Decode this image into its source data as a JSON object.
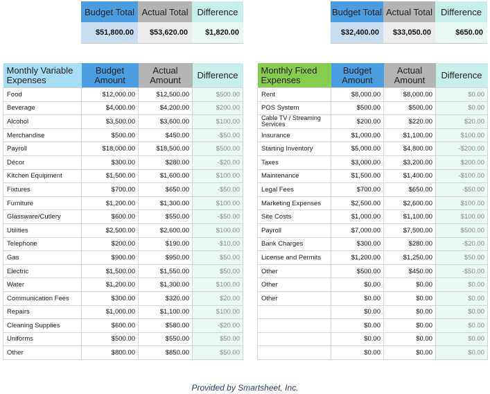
{
  "summary_variable": {
    "budget_label": "Budget Total",
    "actual_label": "Actual Total",
    "diff_label": "Difference",
    "budget_value": "$51,800.00",
    "actual_value": "$53,620.00",
    "diff_value": "$1,820.00"
  },
  "summary_fixed": {
    "budget_label": "Budget Total",
    "actual_label": "Actual Total",
    "diff_label": "Difference",
    "budget_value": "$32,400.00",
    "actual_value": "$33,050.00",
    "diff_value": "$650.00"
  },
  "variable": {
    "headers": [
      "Monthly Variable Expenses",
      "Budget Amount",
      "Actual Amount",
      "Difference"
    ],
    "rows": [
      [
        "Food",
        "$12,000.00",
        "$12,500.00",
        "$500.00"
      ],
      [
        "Beverage",
        "$4,000.00",
        "$4,200.00",
        "$200.00"
      ],
      [
        "Alcohol",
        "$3,500.00",
        "$3,600.00",
        "$100.00"
      ],
      [
        "Merchandise",
        "$500.00",
        "$450.00",
        "-$50.00"
      ],
      [
        "Payroll",
        "$18,000.00",
        "$18,500.00",
        "$500.00"
      ],
      [
        "Décor",
        "$300.00",
        "$280.00",
        "-$20.00"
      ],
      [
        "Kitchen Equipment",
        "$1,500.00",
        "$1,600.00",
        "$100.00"
      ],
      [
        "Fixtures",
        "$700.00",
        "$650.00",
        "-$50.00"
      ],
      [
        "Furniture",
        "$1,200.00",
        "$1,300.00",
        "$100.00"
      ],
      [
        "Glassware/Cutlery",
        "$600.00",
        "$550.00",
        "-$50.00"
      ],
      [
        "Utilities",
        "$2,500.00",
        "$2,600.00",
        "$100.00"
      ],
      [
        "Telephone",
        "$200.00",
        "$190.00",
        "-$10.00"
      ],
      [
        "Gas",
        "$900.00",
        "$950.00",
        "$50.00"
      ],
      [
        "Electric",
        "$1,500.00",
        "$1,550.00",
        "$50.00"
      ],
      [
        "Water",
        "$1,200.00",
        "$1,300.00",
        "$100.00"
      ],
      [
        "Communication Fees",
        "$300.00",
        "$320.00",
        "$20.00"
      ],
      [
        "Repairs",
        "$1,000.00",
        "$1,100.00",
        "$100.00"
      ],
      [
        "Cleaning Supplies",
        "$600.00",
        "$580.00",
        "-$20.00"
      ],
      [
        "Uniforms",
        "$500.00",
        "$550.00",
        "$50.00"
      ],
      [
        "Other",
        "$800.00",
        "$850.00",
        "$50.00"
      ]
    ]
  },
  "fixed": {
    "headers": [
      "Monthly Fixed Expenses",
      "Budget Amount",
      "Actual Amount",
      "Difference"
    ],
    "rows": [
      [
        "Rent",
        "$8,000.00",
        "$8,000.00",
        "$0.00"
      ],
      [
        "POS System",
        "$500.00",
        "$500.00",
        "$0.00"
      ],
      [
        "Cable TV / Streaming Services",
        "$200.00",
        "$220.00",
        "$20.00"
      ],
      [
        "Insurance",
        "$1,000.00",
        "$1,100.00",
        "$100.00"
      ],
      [
        "Starting Inventory",
        "$5,000.00",
        "$4,800.00",
        "-$200.00"
      ],
      [
        "Taxes",
        "$3,000.00",
        "$3,200.00",
        "$200.00"
      ],
      [
        "Maintenance",
        "$1,500.00",
        "$1,400.00",
        "-$100.00"
      ],
      [
        "Legal Fees",
        "$700.00",
        "$650.00",
        "-$50.00"
      ],
      [
        "Marketing Expenses",
        "$2,500.00",
        "$2,600.00",
        "$100.00"
      ],
      [
        "Site Costs",
        "$1,000.00",
        "$1,100.00",
        "$100.00"
      ],
      [
        "Payroll",
        "$7,000.00",
        "$7,500.00",
        "$500.00"
      ],
      [
        "Bank Charges",
        "$300.00",
        "$280.00",
        "-$20.00"
      ],
      [
        "License and Permits",
        "$1,200.00",
        "$1,250.00",
        "$50.00"
      ],
      [
        "Other",
        "$500.00",
        "$450.00",
        "-$50.00"
      ],
      [
        "Other",
        "$0.00",
        "$0.00",
        "$0.00"
      ],
      [
        "Other",
        "$0.00",
        "$0.00",
        "$0.00"
      ],
      [
        "",
        "$0.00",
        "$0.00",
        "$0.00"
      ],
      [
        "",
        "$0.00",
        "$0.00",
        "$0.00"
      ],
      [
        "",
        "$0.00",
        "$0.00",
        "$0.00"
      ],
      [
        "",
        "$0.00",
        "$0.00",
        "$0.00"
      ]
    ]
  },
  "footer": "Provided by Smartsheet, Inc.",
  "colors": {
    "budget_header": "#4a9de0",
    "actual_header": "#b4b4b4",
    "difference_header": "#c5efe8",
    "variable_header": "#a8dcf5",
    "fixed_header": "#86cc4e"
  }
}
